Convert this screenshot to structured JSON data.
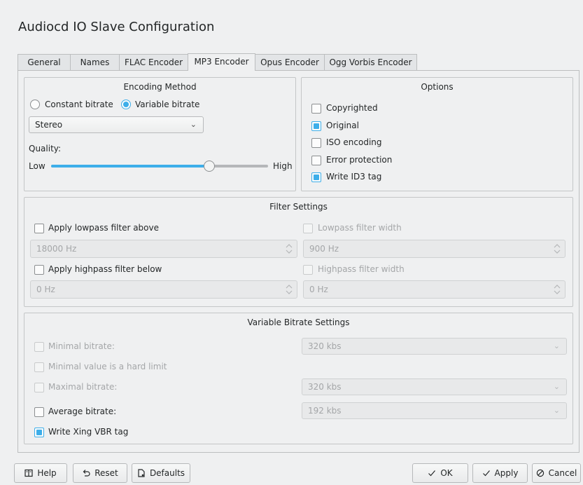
{
  "window": {
    "title": "Audiocd IO Slave Configuration"
  },
  "tabs": [
    "General",
    "Names",
    "FLAC Encoder",
    "MP3 Encoder",
    "Opus Encoder",
    "Ogg Vorbis Encoder"
  ],
  "active_tab": "MP3 Encoder",
  "encoding": {
    "title": "Encoding Method",
    "constant_label": "Constant bitrate",
    "variable_label": "Variable bitrate",
    "selected": "variable",
    "mode_value": "Stereo",
    "quality_label": "Quality:",
    "low_label": "Low",
    "high_label": "High",
    "quality_fraction": 0.73
  },
  "options": {
    "title": "Options",
    "items": [
      {
        "label": "Copyrighted",
        "checked": false
      },
      {
        "label": "Original",
        "checked": true
      },
      {
        "label": "ISO encoding",
        "checked": false
      },
      {
        "label": "Error protection",
        "checked": false
      },
      {
        "label": "Write ID3 tag",
        "checked": true
      }
    ]
  },
  "filter": {
    "title": "Filter Settings",
    "lowpass_label": "Apply lowpass filter above",
    "lowpass_value": "18000 Hz",
    "lowpass_width_label": "Lowpass filter width",
    "lowpass_width_value": "900 Hz",
    "highpass_label": "Apply highpass filter below",
    "highpass_value": "0 Hz",
    "highpass_width_label": "Highpass filter width",
    "highpass_width_value": "0 Hz"
  },
  "vbr": {
    "title": "Variable Bitrate Settings",
    "min_label": "Minimal bitrate:",
    "min_value": "320 kbs",
    "hard_limit_label": "Minimal value is a hard limit",
    "max_label": "Maximal bitrate:",
    "max_value": "320 kbs",
    "avg_label": "Average bitrate:",
    "avg_value": "192 kbs",
    "xing_label": "Write Xing VBR tag"
  },
  "buttons": {
    "help": "Help",
    "reset": "Reset",
    "defaults": "Defaults",
    "ok": "OK",
    "apply": "Apply",
    "cancel": "Cancel"
  },
  "colors": {
    "accent": "#3daee9",
    "window_bg": "#eff0f1"
  }
}
